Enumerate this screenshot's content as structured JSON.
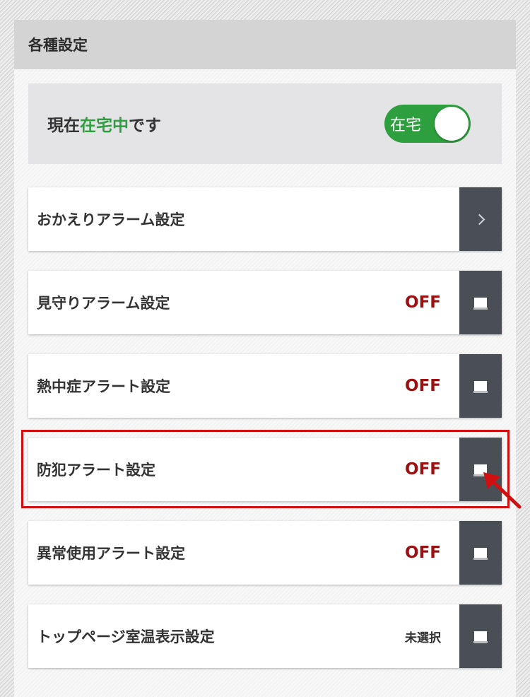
{
  "header": {
    "title": "各種設定"
  },
  "status": {
    "prefix": "現在",
    "highlight": "在宅中",
    "suffix": "です",
    "toggle_label": "在宅",
    "accent_color": "#2e9f3e"
  },
  "settings": [
    {
      "label": "おかえりアラーム設定",
      "value": "",
      "icon": "chevron-right-icon"
    },
    {
      "label": "見守りアラーム設定",
      "value": "OFF",
      "icon": "edit-icon"
    },
    {
      "label": "熱中症アラート設定",
      "value": "OFF",
      "icon": "edit-icon"
    },
    {
      "label": "防犯アラート設定",
      "value": "OFF",
      "icon": "edit-icon"
    },
    {
      "label": "異常使用アラート設定",
      "value": "OFF",
      "icon": "edit-icon"
    },
    {
      "label": "トップページ室温表示設定",
      "value": "未選択",
      "icon": "edit-icon"
    }
  ],
  "colors": {
    "off_text": "#9b1010",
    "button_bg": "#4a4e55",
    "highlight_border": "#d01010"
  }
}
